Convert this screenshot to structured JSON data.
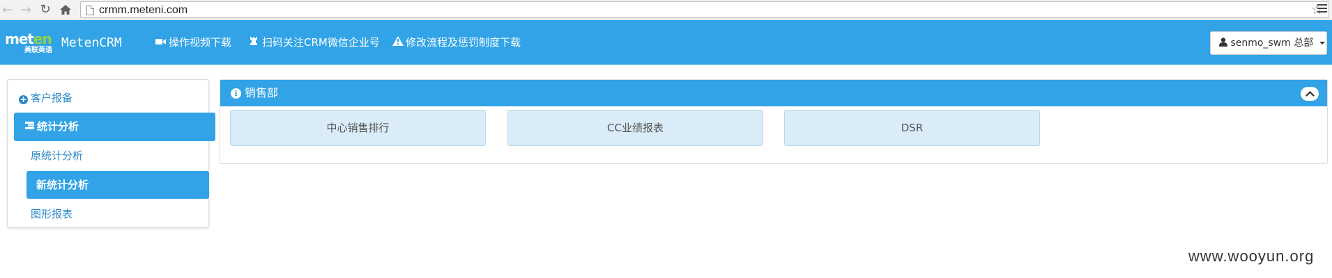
{
  "browser": {
    "url": "crmm.meteni.com",
    "back_icon": "arrow-left-icon",
    "forward_icon": "arrow-right-icon",
    "reload_icon": "reload-icon",
    "home_icon": "home-icon",
    "bookmark_icon": "star-icon",
    "menu_icon": "hamburger-menu-icon"
  },
  "header": {
    "logo_word_1": "met",
    "logo_word_2": "en",
    "logo_sub": "美联英语",
    "brand": "MetenCRM",
    "nav": [
      {
        "label": "操作视频下载",
        "icon": "video-camera-icon"
      },
      {
        "label": "扫码关注CRM微信企业号",
        "icon": "chess-rook-icon"
      },
      {
        "label": "修改流程及惩罚制度下载",
        "icon": "warning-icon"
      }
    ],
    "user": {
      "label": "senmo_swm 总部",
      "icon": "user-icon"
    },
    "colors": {
      "bar": "#31a3e6",
      "logo_accent": "#8fd14f"
    }
  },
  "sidebar": {
    "items": [
      {
        "label": "客户报备",
        "icon": "plus-circle-icon"
      },
      {
        "label": "统计分析",
        "icon": "tasks-icon"
      },
      {
        "label": "原统计分析"
      },
      {
        "label": "新统计分析"
      },
      {
        "label": "图形报表"
      }
    ]
  },
  "panel": {
    "title": "销售部",
    "icon": "info-circle-icon",
    "collapse_icon": "chevron-up-icon",
    "tiles": [
      "中心销售排行",
      "CC业绩报表",
      "DSR"
    ]
  },
  "watermark": "www.wooyun.org"
}
